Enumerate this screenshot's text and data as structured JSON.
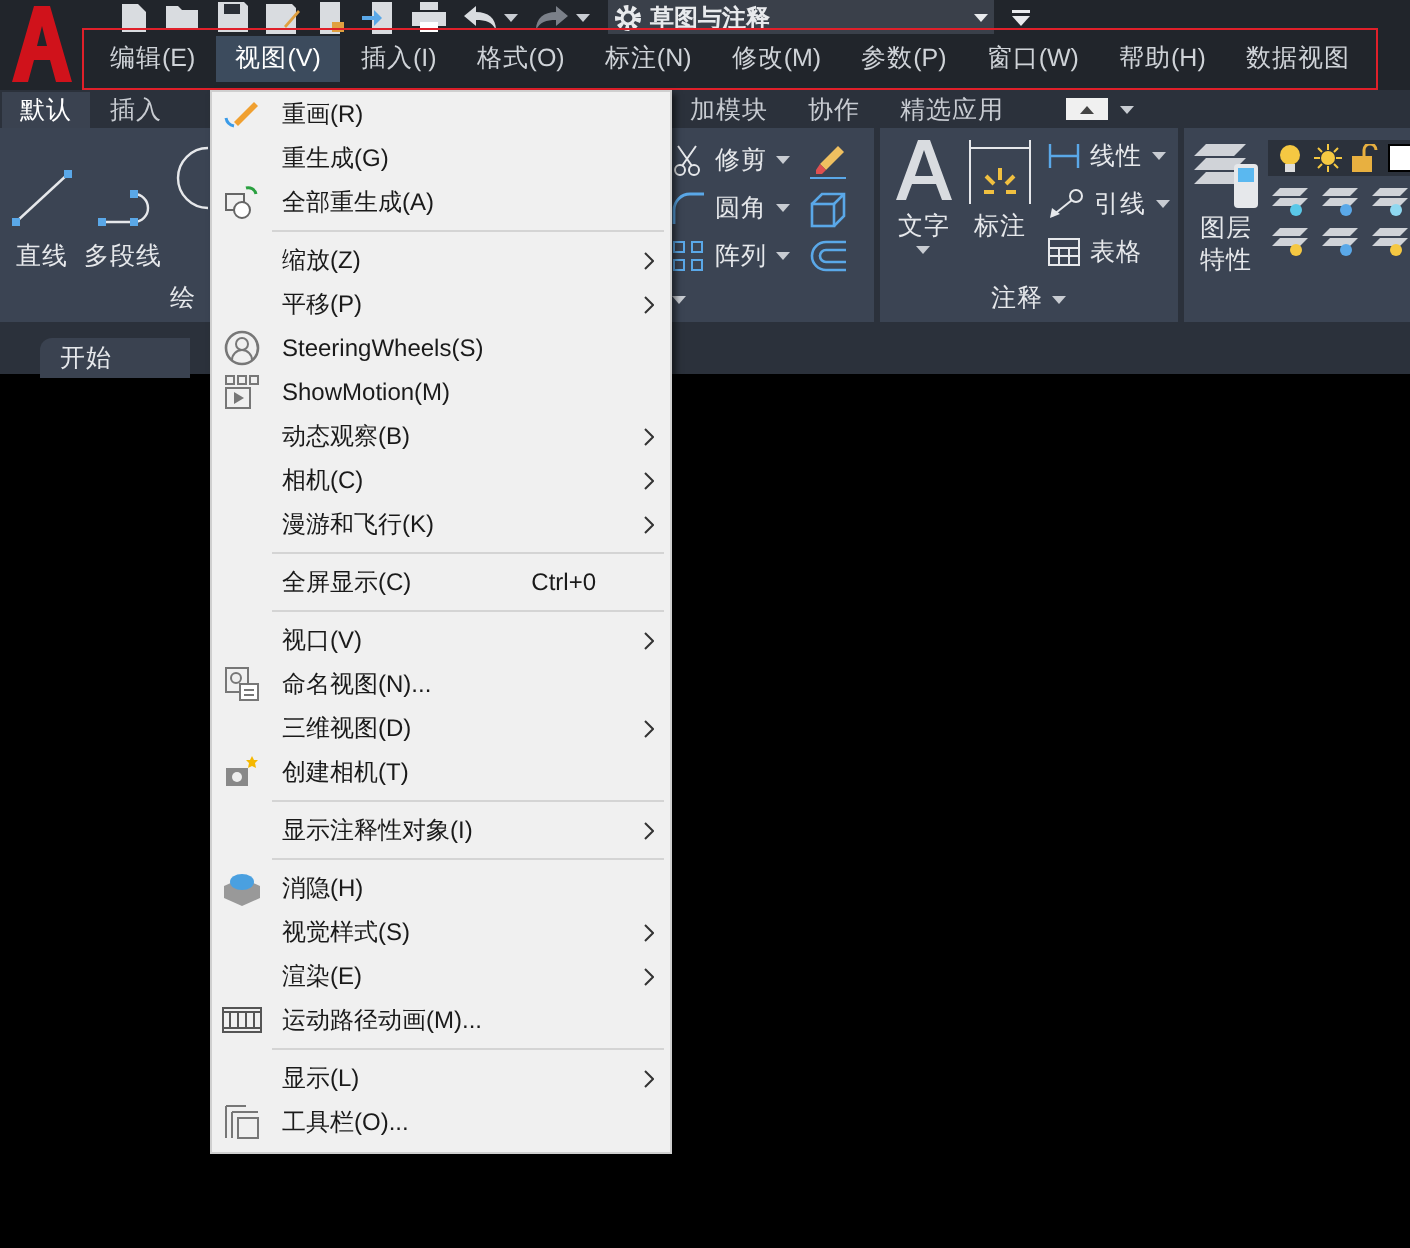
{
  "quick_access": {
    "workspace": "草图与注释"
  },
  "menu_bar": [
    {
      "label": "编辑(E)",
      "selected": false
    },
    {
      "label": "视图(V)",
      "selected": true
    },
    {
      "label": "插入(I)",
      "selected": false
    },
    {
      "label": "格式(O)",
      "selected": false
    },
    {
      "label": "标注(N)",
      "selected": false
    },
    {
      "label": "修改(M)",
      "selected": false
    },
    {
      "label": "参数(P)",
      "selected": false
    },
    {
      "label": "窗口(W)",
      "selected": false
    },
    {
      "label": "帮助(H)",
      "selected": false
    },
    {
      "label": "数据视图",
      "selected": false
    }
  ],
  "ribbon_tabs_left": [
    {
      "label": "默认",
      "selected": true
    },
    {
      "label": "插入",
      "selected": false
    }
  ],
  "ribbon_tabs_right": [
    {
      "label": "加模块",
      "selected": false
    },
    {
      "label": "协作",
      "selected": false
    },
    {
      "label": "精选应用",
      "selected": false
    }
  ],
  "draw_panel": {
    "tools": [
      "直线",
      "多段线"
    ],
    "title": "绘"
  },
  "modify_panel": {
    "tools": [
      "修剪",
      "圆角",
      "阵列"
    ]
  },
  "annotation_panel": {
    "text_tool": "文字",
    "dimension_tool": "标注",
    "tools": [
      "线性",
      "引线",
      "表格"
    ],
    "title": "注释"
  },
  "layers_panel": {
    "tool": "图层特性"
  },
  "file_tabs": [
    {
      "label": "开始",
      "selected": true
    }
  ],
  "view_menu": [
    {
      "kind": "item",
      "label": "重画(R)",
      "submenu": false
    },
    {
      "kind": "item",
      "label": "重生成(G)",
      "submenu": false
    },
    {
      "kind": "item",
      "label": "全部重生成(A)",
      "submenu": false
    },
    {
      "kind": "separator"
    },
    {
      "kind": "item",
      "label": "缩放(Z)",
      "submenu": true
    },
    {
      "kind": "item",
      "label": "平移(P)",
      "submenu": true
    },
    {
      "kind": "item",
      "label": "SteeringWheels(S)",
      "submenu": false
    },
    {
      "kind": "item",
      "label": "ShowMotion(M)",
      "submenu": false
    },
    {
      "kind": "item",
      "label": "动态观察(B)",
      "submenu": true
    },
    {
      "kind": "item",
      "label": "相机(C)",
      "submenu": true
    },
    {
      "kind": "item",
      "label": "漫游和飞行(K)",
      "submenu": true
    },
    {
      "kind": "separator"
    },
    {
      "kind": "item",
      "label": "全屏显示(C)",
      "submenu": false,
      "shortcut": "Ctrl+0"
    },
    {
      "kind": "separator"
    },
    {
      "kind": "item",
      "label": "视口(V)",
      "submenu": true
    },
    {
      "kind": "item",
      "label": "命名视图(N)...",
      "submenu": false
    },
    {
      "kind": "item",
      "label": "三维视图(D)",
      "submenu": true
    },
    {
      "kind": "item",
      "label": "创建相机(T)",
      "submenu": false
    },
    {
      "kind": "separator"
    },
    {
      "kind": "item",
      "label": "显示注释性对象(I)",
      "submenu": true
    },
    {
      "kind": "separator"
    },
    {
      "kind": "item",
      "label": "消隐(H)",
      "submenu": false
    },
    {
      "kind": "item",
      "label": "视觉样式(S)",
      "submenu": true
    },
    {
      "kind": "item",
      "label": "渲染(E)",
      "submenu": true
    },
    {
      "kind": "item",
      "label": "运动路径动画(M)...",
      "submenu": false
    },
    {
      "kind": "separator"
    },
    {
      "kind": "item",
      "label": "显示(L)",
      "submenu": true
    },
    {
      "kind": "item",
      "label": "工具栏(O)...",
      "submenu": false
    }
  ]
}
